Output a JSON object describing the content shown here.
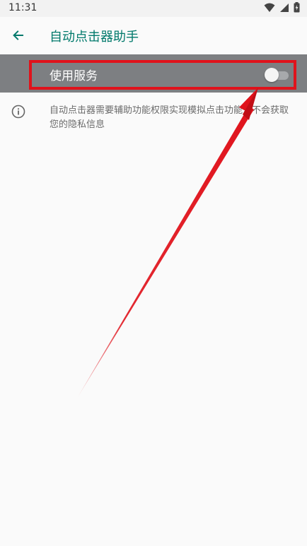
{
  "status_bar": {
    "time": "11:31"
  },
  "app_bar": {
    "title": "自动点击器助手",
    "back_icon": "arrow-back-icon"
  },
  "settings": {
    "service_switch_label": "使用服务",
    "service_enabled": false,
    "info_text": "自动点击器需要辅助功能权限实现模拟点击功能，不会获取您的隐私信息"
  },
  "colors": {
    "accent": "#00796b",
    "row_background": "#7d7f82",
    "highlight_border": "#e0121b",
    "arrow": "#e0121b"
  }
}
